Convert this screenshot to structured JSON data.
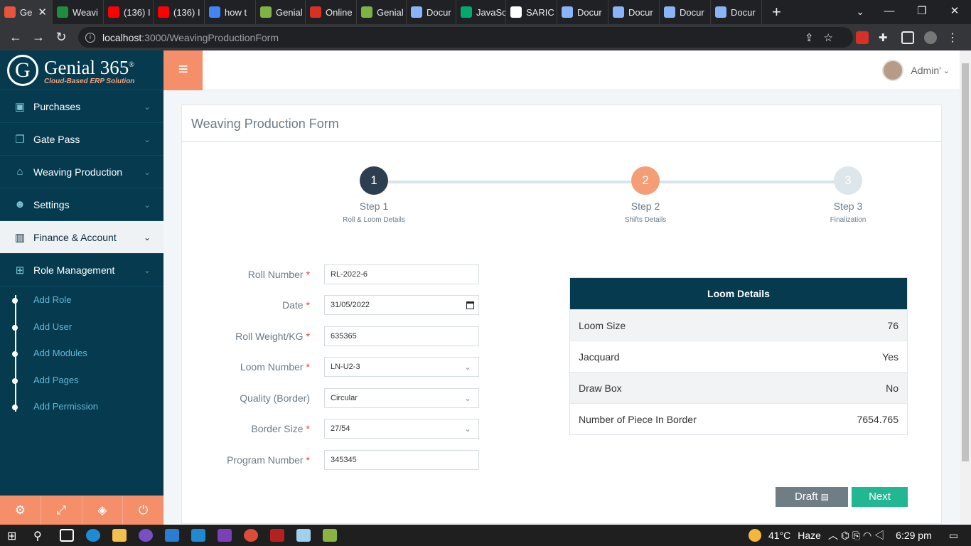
{
  "browser": {
    "tabs": [
      {
        "label": "Ge",
        "color": "#e8553c",
        "active": true
      },
      {
        "label": "Weavi",
        "color": "#1e8e3e"
      },
      {
        "label": "(136) I",
        "color": "#ff0000"
      },
      {
        "label": "(136) I",
        "color": "#ff0000"
      },
      {
        "label": "how t",
        "color": "#4285f4"
      },
      {
        "label": "Genial",
        "color": "#7cb342"
      },
      {
        "label": "Online",
        "color": "#d93025"
      },
      {
        "label": "Genial",
        "color": "#7cb342"
      },
      {
        "label": "Docur",
        "color": "#8ab4f8"
      },
      {
        "label": "JavaSc",
        "color": "#04aa6d"
      },
      {
        "label": "SARIC",
        "color": "#ffffff"
      },
      {
        "label": "Docur",
        "color": "#8ab4f8"
      },
      {
        "label": "Docur",
        "color": "#8ab4f8"
      },
      {
        "label": "Docur",
        "color": "#8ab4f8"
      },
      {
        "label": "Docur",
        "color": "#8ab4f8"
      }
    ],
    "new_tab": "+",
    "url_host": "localhost",
    "url_path": ":3000/WeavingProductionForm"
  },
  "sidebar": {
    "brand": "Genial 365",
    "reg": "®",
    "tagline": "Cloud-Based ERP Solution",
    "items": [
      {
        "label": "Purchases",
        "icon": "archive-icon"
      },
      {
        "label": "Gate Pass",
        "icon": "copy-icon"
      },
      {
        "label": "Weaving Production",
        "icon": "home-icon"
      },
      {
        "label": "Settings",
        "icon": "users-icon"
      },
      {
        "label": "Finance & Account",
        "icon": "bar-chart-icon",
        "active": true
      },
      {
        "label": "Role Management",
        "icon": "windows-icon"
      }
    ],
    "subitems": [
      "Add Role",
      "Add User",
      "Add Modules",
      "Add Pages",
      "Add Permission"
    ]
  },
  "topnav": {
    "user": "Admin'"
  },
  "form": {
    "title": "Weaving Production Form",
    "steps": [
      {
        "num": "1",
        "label": "Step 1",
        "desc": "Roll & Loom Details",
        "color": "#2d3e50"
      },
      {
        "num": "2",
        "label": "Step 2",
        "desc": "Shifts Details",
        "color": "#f59d77"
      },
      {
        "num": "3",
        "label": "Step 3",
        "desc": "Finalization",
        "color": "#dde6ea"
      }
    ],
    "fields": [
      {
        "label": "Roll Number",
        "value": "RL-2022-6",
        "required": true,
        "type": "text"
      },
      {
        "label": "Date",
        "value": "31/05/2022",
        "required": true,
        "type": "date"
      },
      {
        "label": "Roll Weight/KG",
        "value": "635365",
        "required": true,
        "type": "text"
      },
      {
        "label": "Loom Number",
        "value": "LN-U2-3",
        "required": true,
        "type": "select"
      },
      {
        "label": "Quality (Border)",
        "value": "Circular",
        "required": false,
        "type": "select"
      },
      {
        "label": "Border Size",
        "value": "27/54",
        "required": true,
        "type": "select"
      },
      {
        "label": "Program Number",
        "value": "345345",
        "required": true,
        "type": "text"
      }
    ],
    "loom_details": {
      "title": "Loom Details",
      "rows": [
        {
          "key": "Loom Size",
          "value": "76"
        },
        {
          "key": "Jacquard",
          "value": "Yes"
        },
        {
          "key": "Draw Box",
          "value": "No"
        },
        {
          "key": "Number of Piece In Border",
          "value": "7654.765"
        }
      ]
    },
    "draft_label": "Draft",
    "next_label": "Next"
  },
  "taskbar": {
    "temp": "41°C",
    "weather": "Haze",
    "time": "6:29 pm"
  }
}
